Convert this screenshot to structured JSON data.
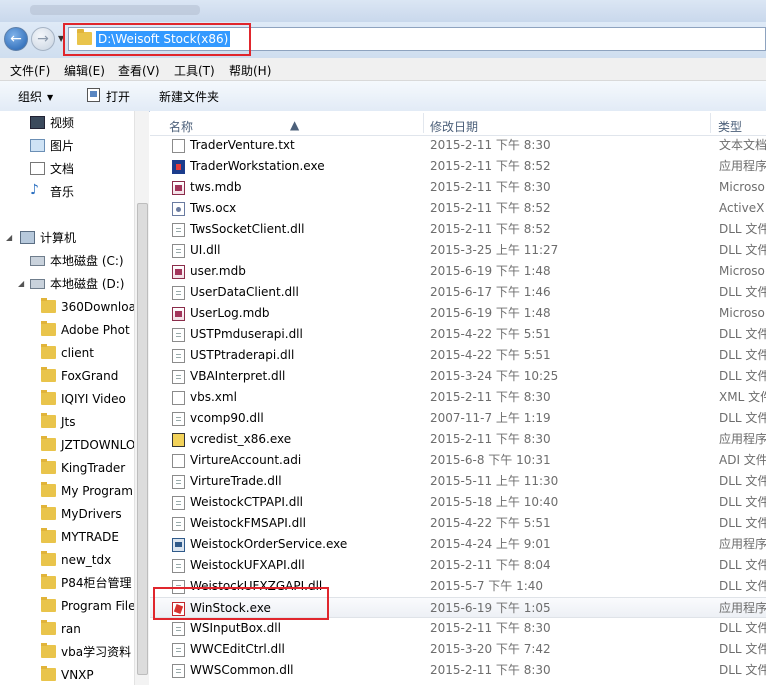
{
  "address": {
    "path": "D:\\Weisoft Stock(x86)"
  },
  "menu": [
    "文件(F)",
    "编辑(E)",
    "查看(V)",
    "工具(T)",
    "帮助(H)"
  ],
  "toolbar": {
    "organize": "组织",
    "open": "打开",
    "new_folder": "新建文件夹"
  },
  "nav": {
    "libraries": [
      "视频",
      "图片",
      "文档",
      "音乐"
    ],
    "computer": "计算机",
    "drives": [
      "本地磁盘 (C:)",
      "本地磁盘 (D:)"
    ],
    "folders": [
      "360Downloa",
      "Adobe Phot",
      "client",
      "FoxGrand",
      "IQIYI Video",
      "Jts",
      "JZTDOWNLO",
      "KingTrader",
      "My Program",
      "MyDrivers",
      "MYTRADE",
      "new_tdx",
      "P84柜台管理",
      "Program File",
      "ran",
      "vba学习资料",
      "VNXP"
    ]
  },
  "columns": {
    "name": "名称",
    "date": "修改日期",
    "type": "类型"
  },
  "files": [
    {
      "name": "TraderVenture.txt",
      "date": "2015-2-11 下午 8:30",
      "type": "文本文档",
      "icon": "txt"
    },
    {
      "name": "TraderWorkstation.exe",
      "date": "2015-2-11 下午 8:52",
      "type": "应用程序",
      "icon": "exe-ws"
    },
    {
      "name": "tws.mdb",
      "date": "2015-2-11 下午 8:30",
      "type": "Microso",
      "icon": "mdb"
    },
    {
      "name": "Tws.ocx",
      "date": "2015-2-11 下午 8:52",
      "type": "ActiveX 控",
      "icon": "ocx"
    },
    {
      "name": "TwsSocketClient.dll",
      "date": "2015-2-11 下午 8:52",
      "type": "DLL 文件",
      "icon": "dll"
    },
    {
      "name": "UI.dll",
      "date": "2015-3-25 上午 11:27",
      "type": "DLL 文件",
      "icon": "dll"
    },
    {
      "name": "user.mdb",
      "date": "2015-6-19 下午 1:48",
      "type": "Microso",
      "icon": "mdb"
    },
    {
      "name": "UserDataClient.dll",
      "date": "2015-6-17 下午 1:46",
      "type": "DLL 文件",
      "icon": "dll"
    },
    {
      "name": "UserLog.mdb",
      "date": "2015-6-19 下午 1:48",
      "type": "Microso",
      "icon": "mdb"
    },
    {
      "name": "USTPmduserapi.dll",
      "date": "2015-4-22 下午 5:51",
      "type": "DLL 文件",
      "icon": "dll"
    },
    {
      "name": "USTPtraderapi.dll",
      "date": "2015-4-22 下午 5:51",
      "type": "DLL 文件",
      "icon": "dll"
    },
    {
      "name": "VBAInterpret.dll",
      "date": "2015-3-24 下午 10:25",
      "type": "DLL 文件",
      "icon": "dll"
    },
    {
      "name": "vbs.xml",
      "date": "2015-2-11 下午 8:30",
      "type": "XML 文件",
      "icon": "txt"
    },
    {
      "name": "vcomp90.dll",
      "date": "2007-11-7 上午 1:19",
      "type": "DLL 文件",
      "icon": "dll"
    },
    {
      "name": "vcredist_x86.exe",
      "date": "2015-2-11 下午 8:30",
      "type": "应用程序",
      "icon": "exe-vc"
    },
    {
      "name": "VirtureAccount.adi",
      "date": "2015-6-8 下午 10:31",
      "type": "ADI 文件",
      "icon": "txt"
    },
    {
      "name": "VirtureTrade.dll",
      "date": "2015-5-11 上午 11:30",
      "type": "DLL 文件",
      "icon": "dll"
    },
    {
      "name": "WeistockCTPAPI.dll",
      "date": "2015-5-18 上午 10:40",
      "type": "DLL 文件",
      "icon": "dll"
    },
    {
      "name": "WeistockFMSAPI.dll",
      "date": "2015-4-22 下午 5:51",
      "type": "DLL 文件",
      "icon": "dll"
    },
    {
      "name": "WeistockOrderService.exe",
      "date": "2015-4-24 上午 9:01",
      "type": "应用程序",
      "icon": "exe-os"
    },
    {
      "name": "WeistockUFXAPI.dll",
      "date": "2015-2-11 下午 8:04",
      "type": "DLL 文件",
      "icon": "dll"
    },
    {
      "name": "WeistockUFXZGAPI.dll",
      "date": "2015-5-7 下午 1:40",
      "type": "DLL 文件",
      "icon": "dll"
    },
    {
      "name": "WinStock.exe",
      "date": "2015-6-19 下午 1:05",
      "type": "应用程序",
      "icon": "exe-win"
    },
    {
      "name": "WSInputBox.dll",
      "date": "2015-2-11 下午 8:30",
      "type": "DLL 文件",
      "icon": "dll"
    },
    {
      "name": "WWCEditCtrl.dll",
      "date": "2015-3-20 下午 7:42",
      "type": "DLL 文件",
      "icon": "dll"
    },
    {
      "name": "WWSCommon.dll",
      "date": "2015-2-11 下午 8:30",
      "type": "DLL 文件",
      "icon": "dll"
    }
  ]
}
